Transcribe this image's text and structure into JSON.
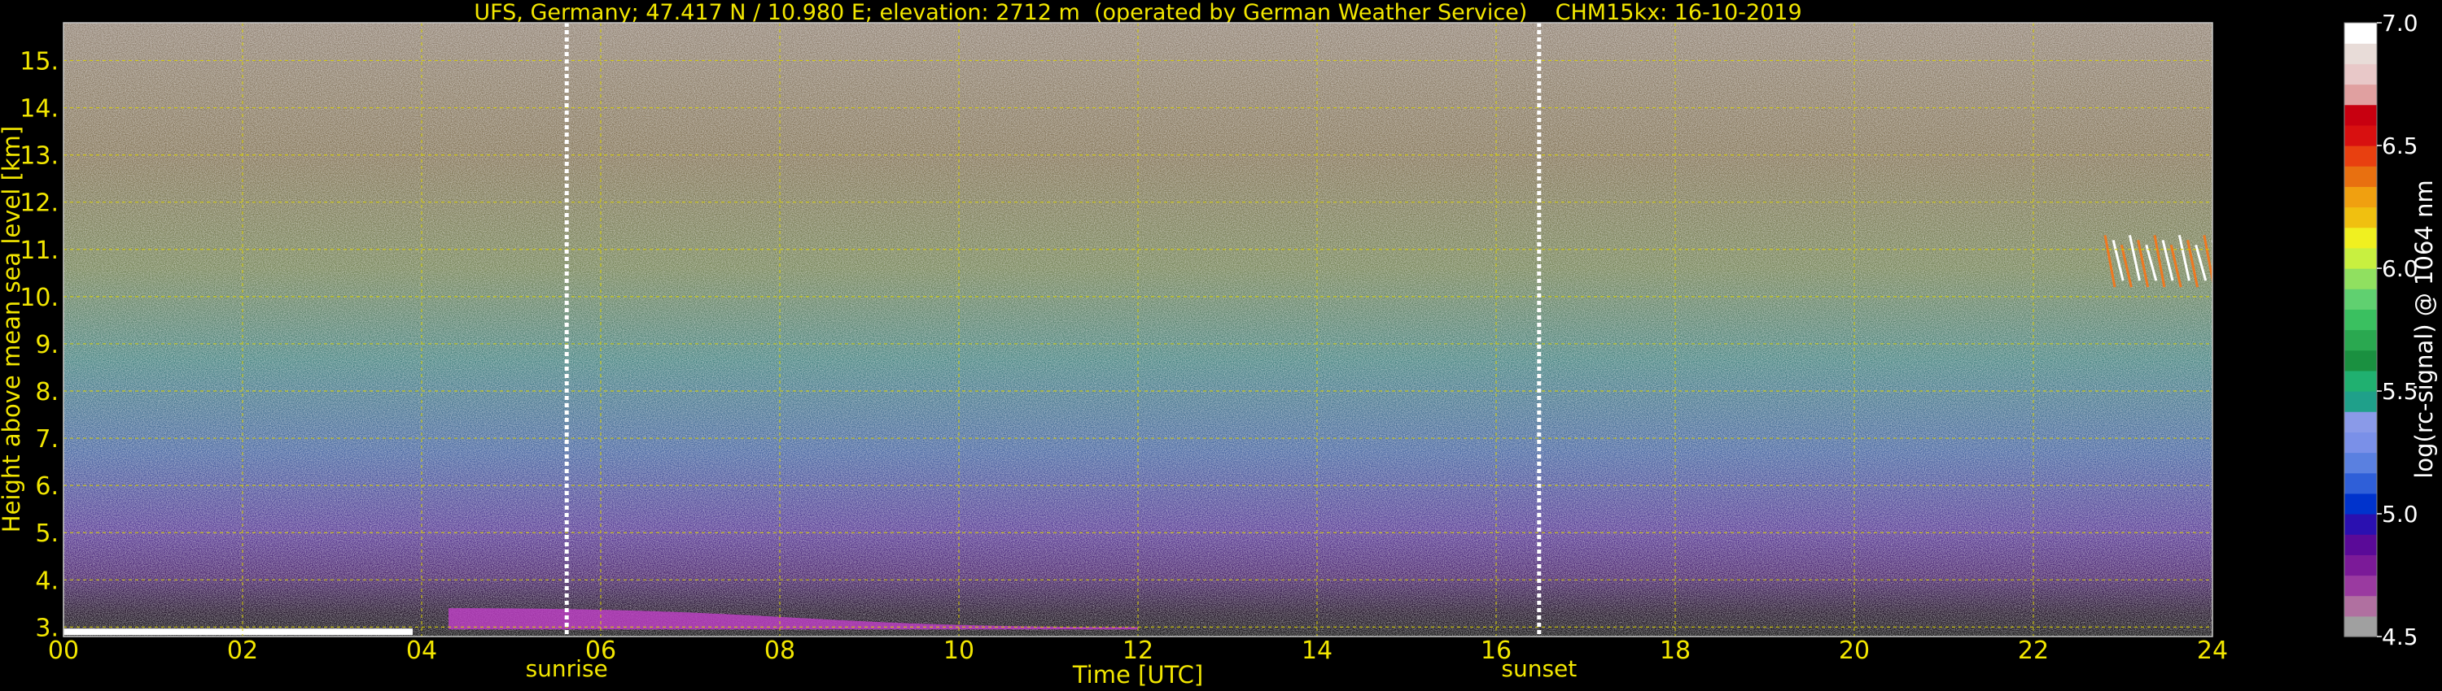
{
  "chart_data": {
    "type": "heatmap",
    "title": "UFS, Germany; 47.417 N / 10.980 E; elevation: 2712 m  (operated by German Weather Service)    CHM15kx: 16-10-2019",
    "xlabel": "Time [UTC]",
    "ylabel": "Height above mean sea level [km]",
    "xlim": [
      0,
      24
    ],
    "ylim": [
      2.8,
      15.8
    ],
    "x_ticks": [
      "00",
      "02",
      "04",
      "06",
      "08",
      "10",
      "12",
      "14",
      "16",
      "18",
      "20",
      "22",
      "24"
    ],
    "y_ticks": [
      "3.",
      "4.",
      "5.",
      "6.",
      "7.",
      "8.",
      "9.",
      "10.",
      "11.",
      "12.",
      "13.",
      "14.",
      "15."
    ],
    "grid": true,
    "colorbar": {
      "label": "log(rc-signal) @ 1064 nm",
      "range": [
        4.5,
        7.0
      ],
      "ticks": [
        "4.5",
        "5.0",
        "5.5",
        "6.0",
        "6.5",
        "7.0"
      ],
      "colors": [
        "#a0a0a0",
        "#b070a0",
        "#9a3aa0",
        "#7b1a98",
        "#5a0a98",
        "#2a10b0",
        "#0033cc",
        "#2f5fd8",
        "#5a80e0",
        "#7a90e8",
        "#8a9ae8",
        "#1fa08a",
        "#20b070",
        "#1a9040",
        "#2aa850",
        "#3ac060",
        "#60d070",
        "#90e060",
        "#c8f040",
        "#f0f020",
        "#f0c010",
        "#f0a010",
        "#e87010",
        "#e84010",
        "#d81010",
        "#c80010",
        "#e0a0a0",
        "#e8c8c8",
        "#e8dcd8",
        "#ffffff"
      ]
    },
    "events": [
      {
        "label": "sunrise",
        "time": 5.62
      },
      {
        "label": "sunset",
        "time": 16.48
      }
    ],
    "features": [
      {
        "kind": "aerosol-layer",
        "x": [
          4.3,
          12.0
        ],
        "y_top": [
          3.4,
          3.0
        ]
      },
      {
        "kind": "low-cloud",
        "x": [
          0.0,
          3.9
        ],
        "y": 2.9
      },
      {
        "kind": "cirrus",
        "x": [
          22.8,
          24.0
        ],
        "y": [
          10.2,
          11.3
        ]
      }
    ]
  }
}
